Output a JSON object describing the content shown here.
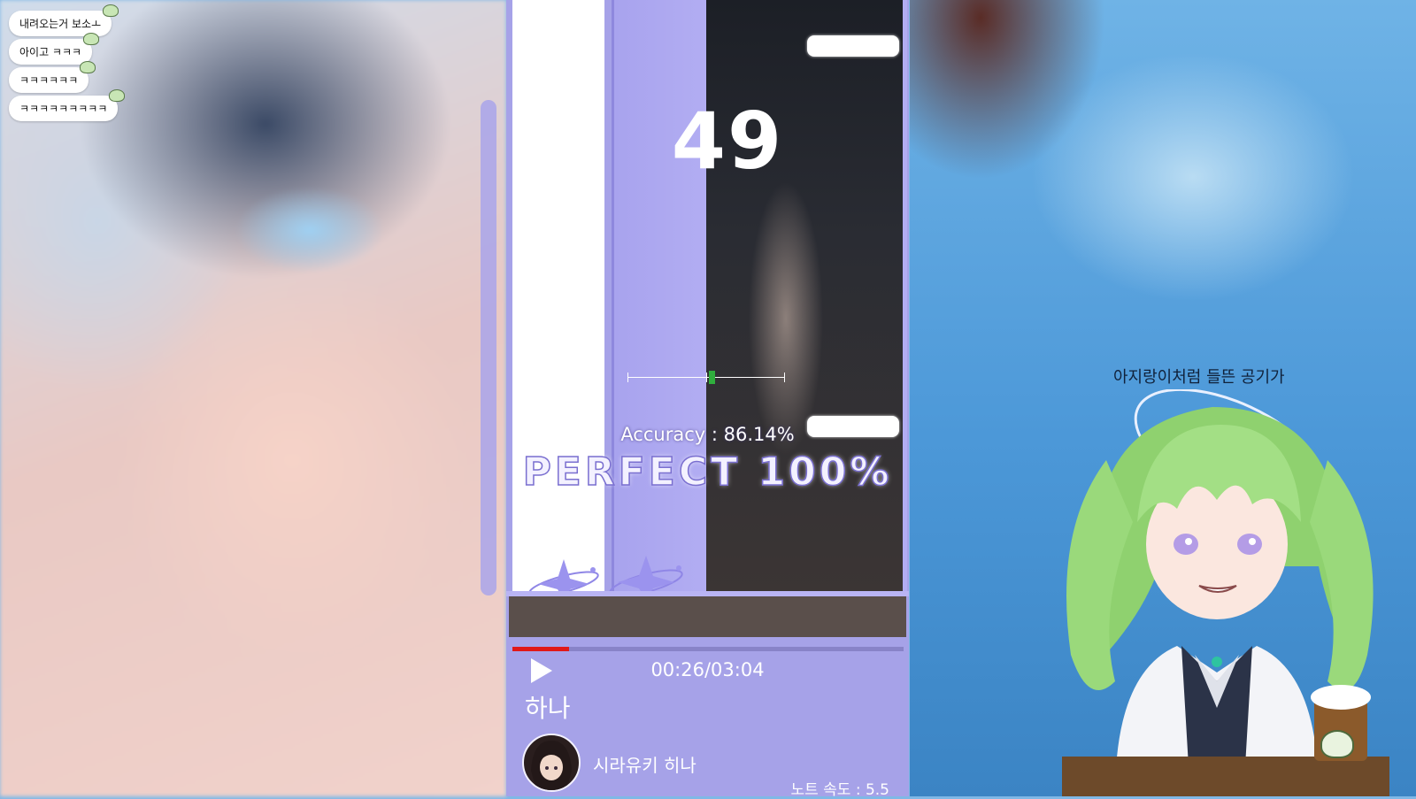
{
  "chat": {
    "messages": [
      {
        "text": "내려오는거 보소ㅗ"
      },
      {
        "text": "아이고 ㅋㅋㅋ"
      },
      {
        "text": "ㅋㅋㅋㅋㅋㅋ"
      },
      {
        "text": "ㅋㅋㅋㅋㅋㅋㅋㅋㅋ"
      }
    ]
  },
  "game": {
    "combo": "49",
    "accuracy": "Accuracy : 86.14%",
    "judgement": "PERFECT 100%",
    "progress": 0.144,
    "time": "00:26/03:04",
    "song_title": "하나",
    "artist": "시라유키 히나",
    "note_speed": "노트 속도 : 5.5",
    "colors": {
      "panel": "#a6a2e8",
      "perfect_stroke": "#7a6fd0",
      "progress": "#e01818",
      "hit_marker": "#2fae3d"
    }
  },
  "overlay": {
    "lyric": "아지랑이처럼 들뜬 공기가"
  }
}
